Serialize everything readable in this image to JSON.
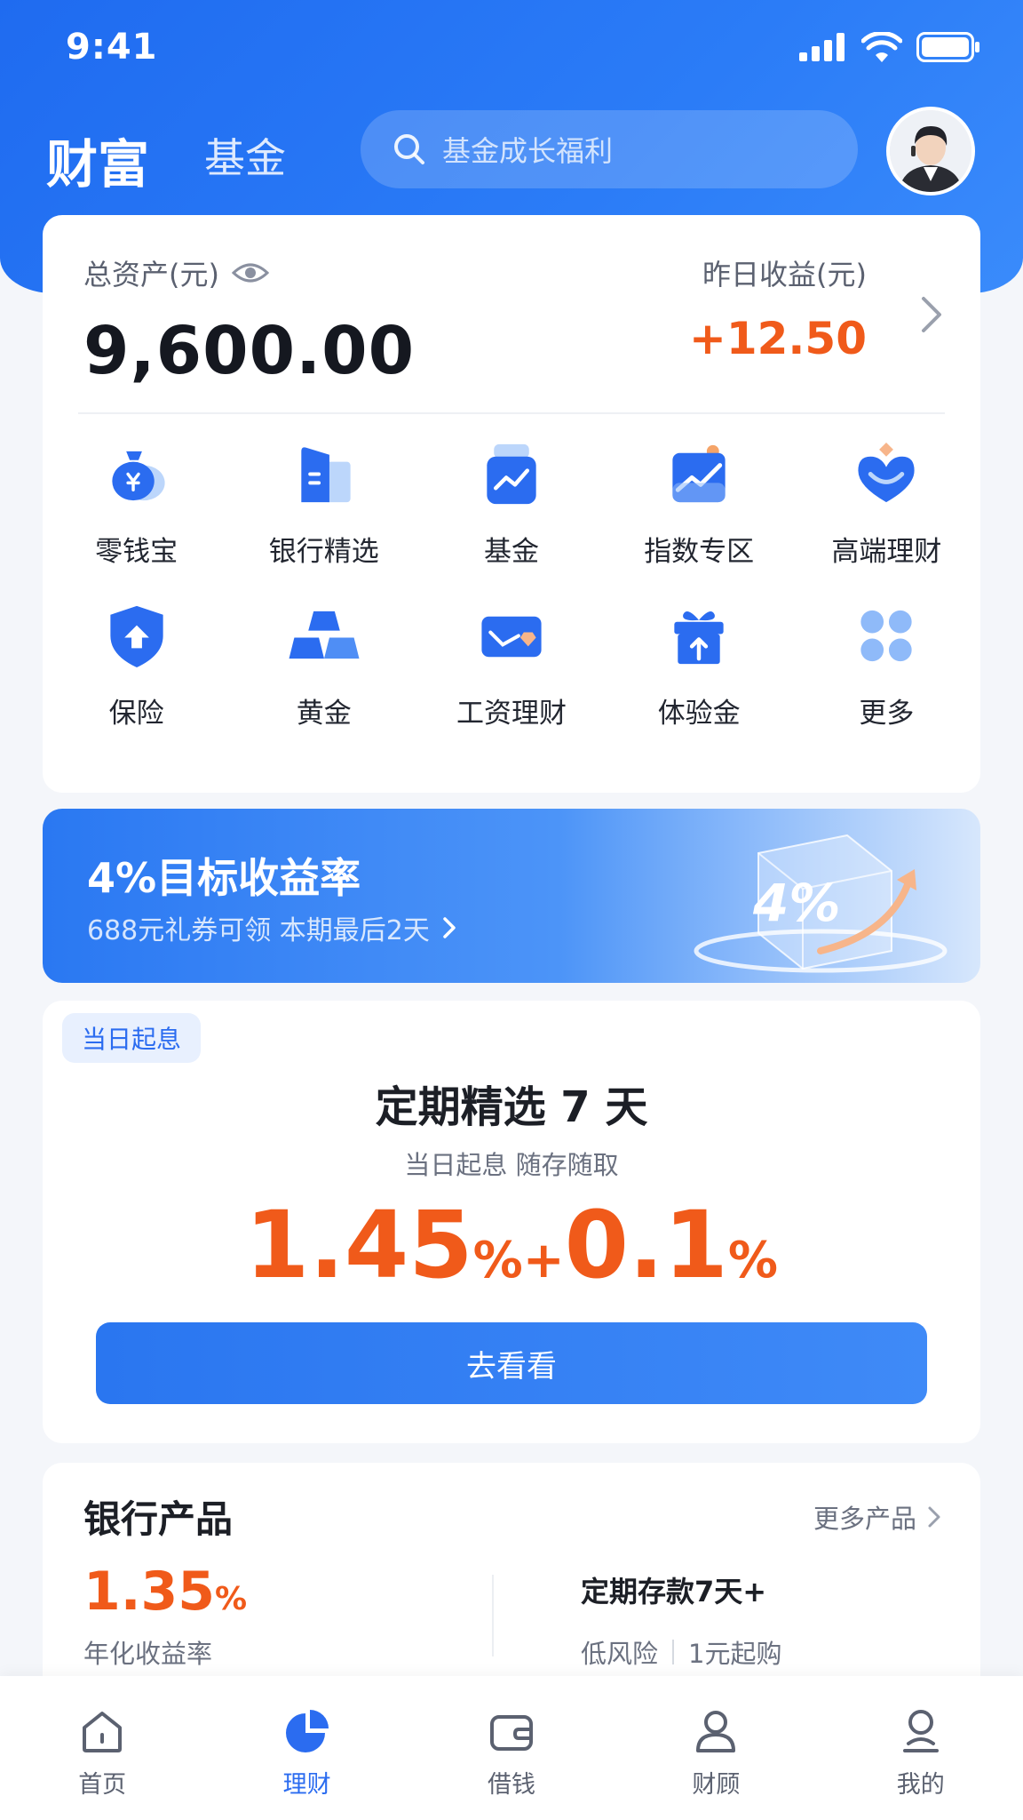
{
  "status_bar": {
    "time": "9:41"
  },
  "header": {
    "title": "财富",
    "subtitle": "基金",
    "search": {
      "placeholder": "基金成长福利"
    }
  },
  "assets": {
    "total_label": "总资产(元)",
    "total_value": "9,600.00",
    "yesterday_label": "昨日收益(元)",
    "yesterday_value": "+12.50"
  },
  "quick_entries": [
    {
      "label": "零钱宝",
      "icon": "money-bag-icon"
    },
    {
      "label": "银行精选",
      "icon": "bank-building-icon"
    },
    {
      "label": "基金",
      "icon": "fund-chart-icon"
    },
    {
      "label": "指数专区",
      "icon": "index-trend-icon"
    },
    {
      "label": "高端理财",
      "icon": "premium-heart-icon"
    },
    {
      "label": "保险",
      "icon": "shield-icon"
    },
    {
      "label": "黄金",
      "icon": "gold-bars-icon"
    },
    {
      "label": "工资理财",
      "icon": "salary-card-icon"
    },
    {
      "label": "体验金",
      "icon": "gift-box-icon"
    },
    {
      "label": "更多",
      "icon": "more-grid-icon"
    }
  ],
  "banner": {
    "title": "4%目标收益率",
    "subtitle": "688元礼券可领 本期最后2天",
    "badge": "4%"
  },
  "deposit": {
    "tag": "当日起息",
    "title": "定期精选 7 天",
    "subtitle": "当日起息 随存随取",
    "rate_main": "1.45",
    "rate_plus": "%+",
    "rate_extra": "0.1",
    "rate_unit": "%",
    "button": "去看看"
  },
  "bank_products": {
    "title": "银行产品",
    "more": "更多产品",
    "rate": "1.35",
    "rate_unit": "%",
    "rate_label": "年化收益率",
    "product_name": "定期存款7天+",
    "risk": "低风险",
    "min_buy": "1元起购"
  },
  "tabs": [
    {
      "label": "首页",
      "icon": "home-icon",
      "active": false
    },
    {
      "label": "理财",
      "icon": "pie-chart-icon",
      "active": true
    },
    {
      "label": "借钱",
      "icon": "wallet-icon",
      "active": false
    },
    {
      "label": "财顾",
      "icon": "advisor-icon",
      "active": false
    },
    {
      "label": "我的",
      "icon": "user-icon",
      "active": false
    }
  ],
  "colors": {
    "brand_blue": "#2b6cf0",
    "profit_orange": "#f05a1a"
  }
}
